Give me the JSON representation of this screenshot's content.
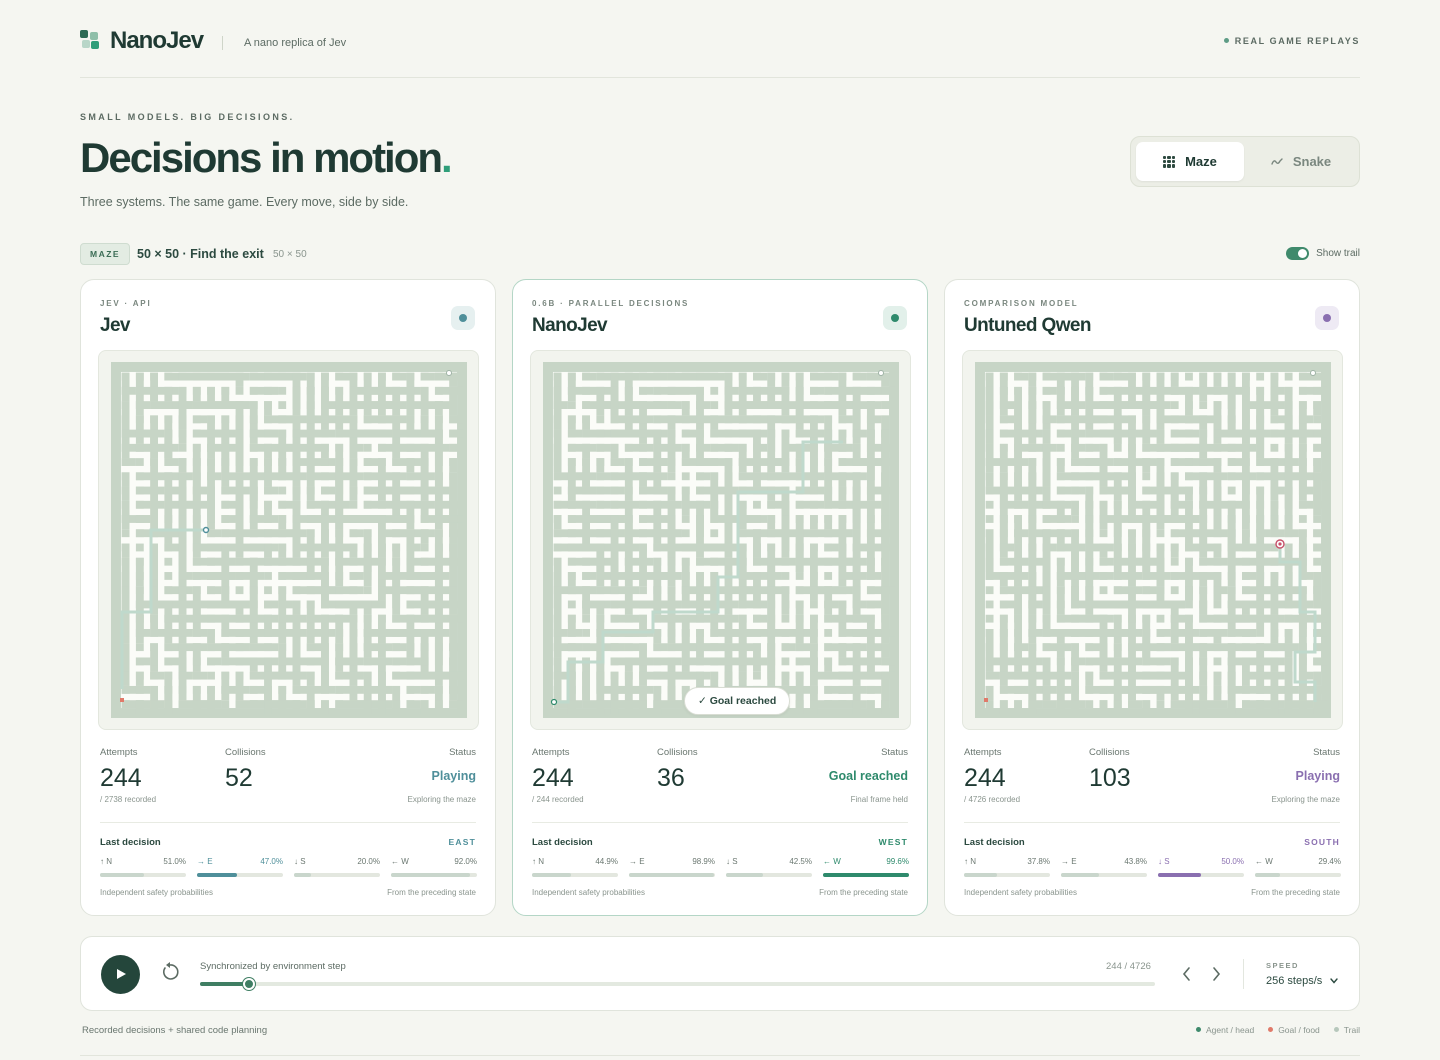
{
  "header": {
    "brand": "NanoJev",
    "tagline": "A nano replica of Jev",
    "replays": "REAL GAME REPLAYS"
  },
  "hero": {
    "eyebrow": "SMALL MODELS. BIG DECISIONS.",
    "title": "Decisions in motion",
    "period": ".",
    "subtitle": "Three systems. The same game. Every move, side by side."
  },
  "mode_toggle": {
    "options": [
      {
        "label": "Maze",
        "icon": "grid-icon",
        "active": true
      },
      {
        "label": "Snake",
        "icon": "snake-icon",
        "active": false
      }
    ]
  },
  "game_info": {
    "badge": "MAZE",
    "title": "50 × 50 · Find the exit",
    "size": "50 × 50",
    "trail_label": "Show trail",
    "trail_on": true
  },
  "panels": [
    {
      "eyebrow": "JEV · API",
      "title": "Jev",
      "accent": "#4f8f9a",
      "chip_bg": "#e6f0f0",
      "attempts_label": "Attempts",
      "attempts": "244",
      "recorded": "/ 2738 recorded",
      "collisions_label": "Collisions",
      "collisions": "52",
      "status_label": "Status",
      "status": "Playing",
      "status_note": "Exploring the maze",
      "last_decision_label": "Last decision",
      "direction": "EAST",
      "probs": [
        {
          "label": "↑ N",
          "value": "51.0%",
          "p": 0.51,
          "active": false
        },
        {
          "label": "→ E",
          "value": "47.0%",
          "p": 0.47,
          "active": true
        },
        {
          "label": "↓ S",
          "value": "20.0%",
          "p": 0.2,
          "active": false
        },
        {
          "label": "← W",
          "value": "92.0%",
          "p": 0.92,
          "active": false
        }
      ],
      "foot_left": "Independent safety probabilities",
      "foot_right": "From the preceding state"
    },
    {
      "eyebrow": "0.6B · PARALLEL DECISIONS",
      "title": "NanoJev",
      "accent": "#2e8a6c",
      "chip_bg": "#e2f0ea",
      "attempts_label": "Attempts",
      "attempts": "244",
      "recorded": "/ 244 recorded",
      "collisions_label": "Collisions",
      "collisions": "36",
      "status_label": "Status",
      "status": "Goal reached",
      "status_note": "Final frame held",
      "goal_pill": "✓ Goal reached",
      "last_decision_label": "Last decision",
      "direction": "WEST",
      "probs": [
        {
          "label": "↑ N",
          "value": "44.9%",
          "p": 0.449,
          "active": false
        },
        {
          "label": "→ E",
          "value": "98.9%",
          "p": 0.989,
          "active": false
        },
        {
          "label": "↓ S",
          "value": "42.5%",
          "p": 0.425,
          "active": false
        },
        {
          "label": "← W",
          "value": "99.6%",
          "p": 0.996,
          "active": true
        }
      ],
      "foot_left": "Independent safety probabilities",
      "foot_right": "From the preceding state"
    },
    {
      "eyebrow": "COMPARISON MODEL",
      "title": "Untuned Qwen",
      "accent": "#8a6fb0",
      "chip_bg": "#eeeaf4",
      "attempts_label": "Attempts",
      "attempts": "244",
      "recorded": "/ 4726 recorded",
      "collisions_label": "Collisions",
      "collisions": "103",
      "status_label": "Status",
      "status": "Playing",
      "status_note": "Exploring the maze",
      "last_decision_label": "Last decision",
      "direction": "SOUTH",
      "probs": [
        {
          "label": "↑ N",
          "value": "37.8%",
          "p": 0.378,
          "active": false
        },
        {
          "label": "→ E",
          "value": "43.8%",
          "p": 0.438,
          "active": false
        },
        {
          "label": "↓ S",
          "value": "50.0%",
          "p": 0.5,
          "active": true
        },
        {
          "label": "← W",
          "value": "29.4%",
          "p": 0.294,
          "active": false
        }
      ],
      "foot_left": "Independent safety probabilities",
      "foot_right": "From the preceding state"
    }
  ],
  "player": {
    "sync_label": "Synchronized by environment step",
    "counter": "244 / 4726",
    "progress": 0.0516,
    "speed_label": "SPEED",
    "speed_value": "256 steps/s"
  },
  "footer": {
    "left": "Recorded decisions + shared code planning",
    "legend": [
      {
        "label": "Agent / head",
        "color": "#3f8a6c"
      },
      {
        "label": "Goal / food",
        "color": "#e07a6a"
      },
      {
        "label": "Trail",
        "color": "#b7c8bc"
      }
    ]
  }
}
